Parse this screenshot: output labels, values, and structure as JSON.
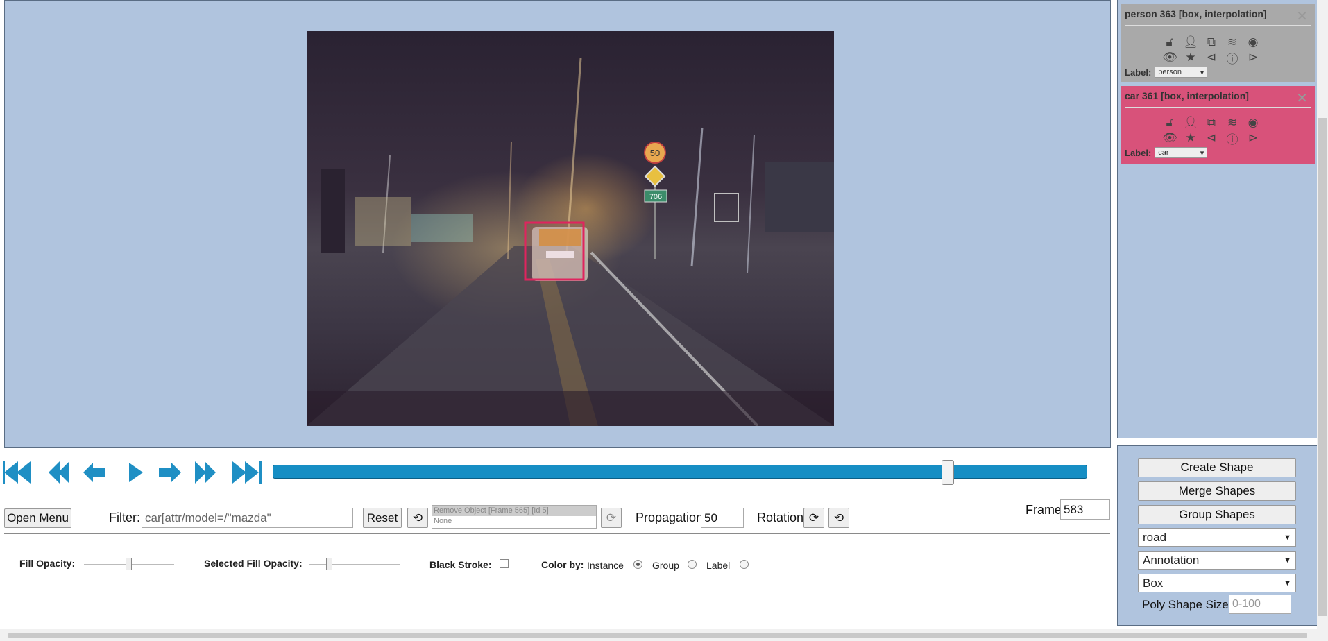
{
  "objects": [
    {
      "title": "person 363 [box, interpolation]",
      "label_prefix": "Label:",
      "label_value": "person",
      "color": "#a9a9a9"
    },
    {
      "title": "car 361 [box, interpolation]",
      "label_prefix": "Label:",
      "label_value": "car",
      "color": "#d8527a"
    }
  ],
  "toolbar": {
    "open_menu": "Open Menu",
    "filter_label": "Filter:",
    "filter_value": "car[attr/model=/\"mazda\"",
    "reset": "Reset",
    "history_top": "Remove Object [Frame 565] [Id 5]",
    "history_bottom": "None",
    "propagation_label": "Propagation",
    "propagation_value": "50",
    "rotation_label": "Rotation",
    "frame_label": "Frame",
    "frame_value": "583"
  },
  "settings": {
    "fill_opacity": "Fill Opacity:",
    "selected_fill_opacity": "Selected Fill Opacity:",
    "black_stroke": "Black Stroke:",
    "color_by": "Color by:",
    "instance": "Instance",
    "group": "Group",
    "label": "Label",
    "color_by_selected": "Instance"
  },
  "side_controls": {
    "create_shape": "Create Shape",
    "merge_shapes": "Merge Shapes",
    "group_shapes": "Group Shapes",
    "label_select": "road",
    "mode_select": "Annotation",
    "shape_select": "Box",
    "poly_size_label": "Poly Shape Size:",
    "poly_size_placeholder": "0-100"
  },
  "frame_image": {
    "sign_speed": "50",
    "sign_route": "706",
    "selected_box_color": "#e0245e"
  },
  "player": {
    "progress_fraction": 0.68
  },
  "colors": {
    "panel_bg": "#b0c4de",
    "accent": "#168ec4"
  }
}
